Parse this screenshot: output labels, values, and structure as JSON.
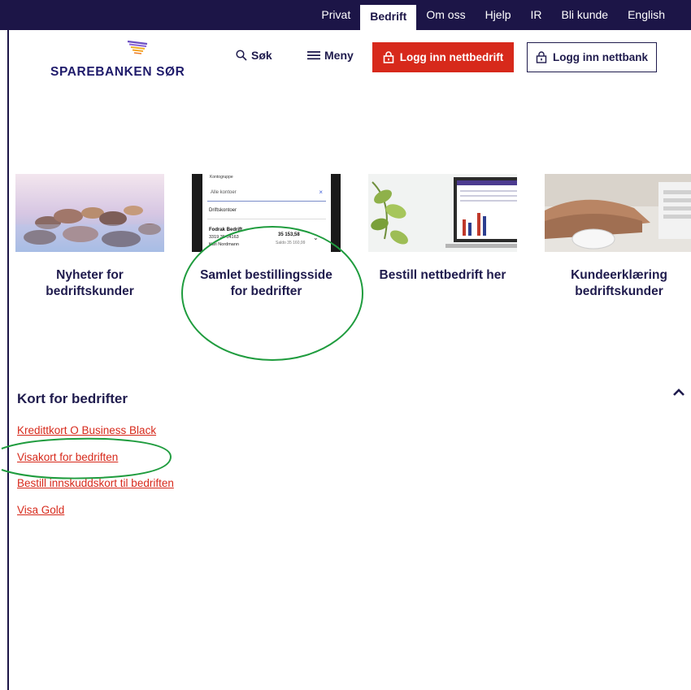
{
  "topnav": {
    "items": [
      {
        "label": "Privat"
      },
      {
        "label": "Bedrift"
      },
      {
        "label": "Om oss"
      },
      {
        "label": "Hjelp"
      },
      {
        "label": "IR"
      },
      {
        "label": "Bli kunde"
      },
      {
        "label": "English"
      }
    ],
    "active": "Bedrift"
  },
  "header": {
    "logo_text": "SPAREBANKEN SØR",
    "search_label": "Søk",
    "menu_label": "Meny",
    "login_bedrift_label": "Logg inn nettbedrift",
    "login_bank_label": "Logg inn nettbank"
  },
  "cards": [
    {
      "title": "Nyheter for bedriftskunder",
      "icon": "stones-image"
    },
    {
      "title": "Samlet bestillingsside for bedrifter",
      "icon": "phone-screen-image",
      "phone": {
        "group_label": "Kontogruppe",
        "select_value": "Alle kontoer",
        "section_label": "Driftskontoer",
        "account_name": "Fodrak Bedrift",
        "account_number": "3319 35 04163",
        "account_owner": "Kari Nordmann",
        "amount": "35 153,58",
        "saldo": "Saldo 35 160,99"
      }
    },
    {
      "title": "Bestill nettbedrift her",
      "icon": "laptop-image"
    },
    {
      "title": "Kundeerklæring bedriftskunder",
      "icon": "mouse-hand-image"
    }
  ],
  "section": {
    "title": "Kort for bedrifter",
    "links": [
      {
        "label": "Kredittkort O Business Black"
      },
      {
        "label": "Visakort for bedriften"
      },
      {
        "label": "Bestill innskuddskort til bedriften"
      },
      {
        "label": "Visa Gold"
      }
    ]
  },
  "colors": {
    "navy": "#1c1547",
    "brand_red": "#d7291b",
    "annotation_green": "#1f9c3e"
  }
}
